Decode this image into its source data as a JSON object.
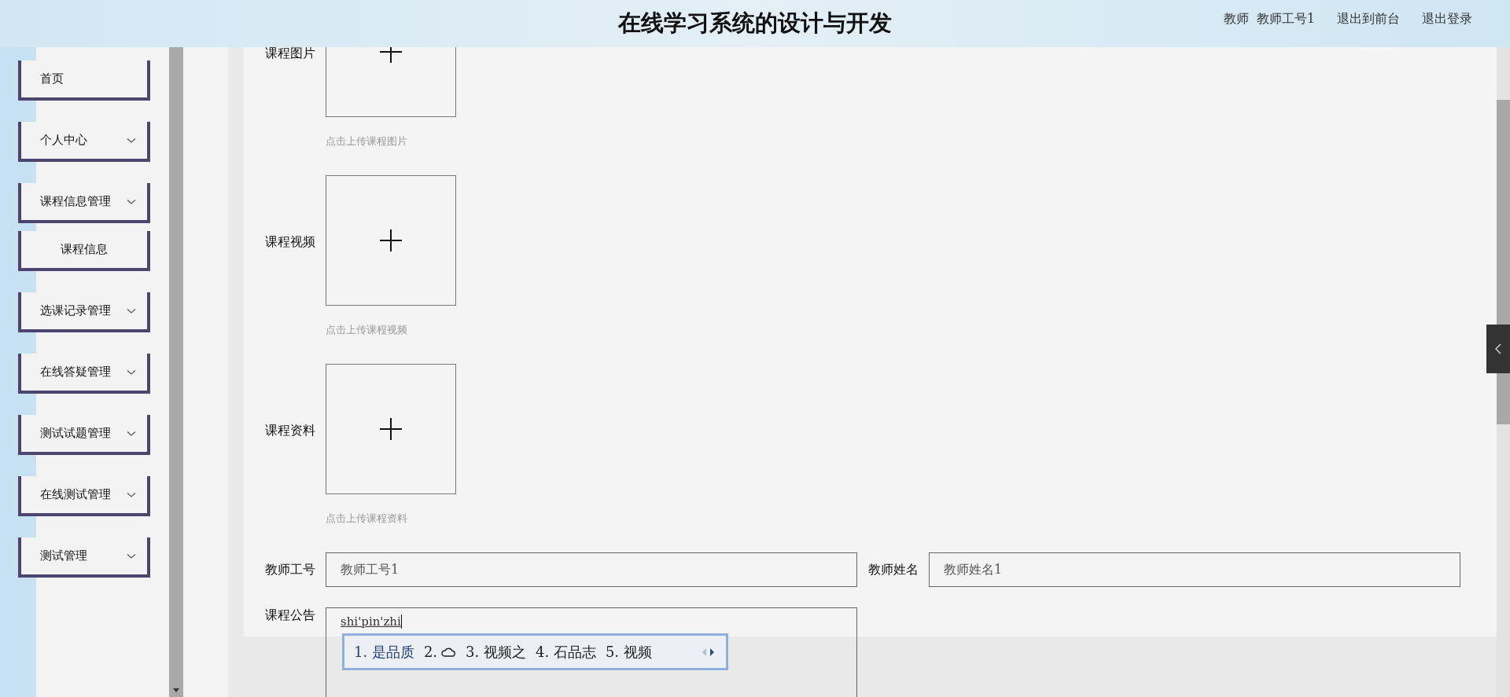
{
  "header": {
    "title": "在线学习系统的设计与开发",
    "user_role": "教师",
    "user_name": "教师工号1",
    "links": [
      "退出到前台",
      "退出登录"
    ]
  },
  "sidebar": {
    "items": [
      {
        "label": "首页",
        "expandable": false
      },
      {
        "label": "个人中心",
        "expandable": true
      },
      {
        "label": "课程信息管理",
        "expandable": true,
        "children": [
          {
            "label": "课程信息"
          }
        ]
      },
      {
        "label": "选课记录管理",
        "expandable": true
      },
      {
        "label": "在线答疑管理",
        "expandable": true
      },
      {
        "label": "测试试题管理",
        "expandable": true
      },
      {
        "label": "在线测试管理",
        "expandable": true
      },
      {
        "label": "测试管理",
        "expandable": true
      }
    ]
  },
  "form": {
    "uploads": [
      {
        "label": "课程图片",
        "hint": "点击上传课程图片"
      },
      {
        "label": "课程视频",
        "hint": "点击上传课程视频"
      },
      {
        "label": "课程资料",
        "hint": "点击上传课程资料"
      }
    ],
    "fields": [
      {
        "label": "教师工号",
        "value": "教师工号1"
      },
      {
        "label": "教师姓名",
        "value": "教师姓名1"
      }
    ],
    "notice": {
      "label": "课程公告",
      "composing": "shi'pin'zhi"
    }
  },
  "ime": {
    "candidates": [
      {
        "kind": "text",
        "label": "1. 是品质",
        "selected": true
      },
      {
        "kind": "cloud",
        "label": "2.",
        "selected": false
      },
      {
        "kind": "text",
        "label": "3. 视频之",
        "selected": false
      },
      {
        "kind": "text",
        "label": "4. 石品志",
        "selected": false
      },
      {
        "kind": "text",
        "label": "5. 视频",
        "selected": false
      }
    ]
  }
}
